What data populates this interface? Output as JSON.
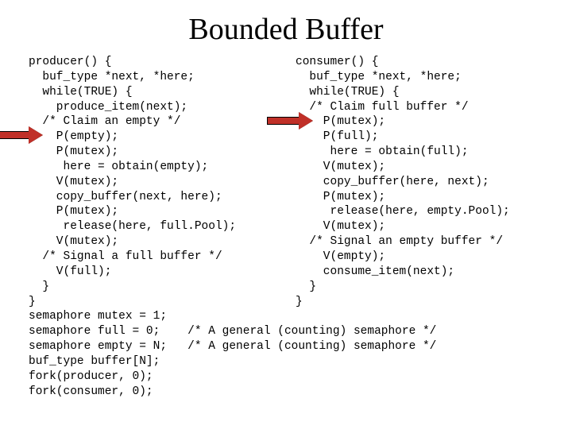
{
  "title": "Bounded Buffer",
  "producer_code": "producer() {\n  buf_type *next, *here;\n  while(TRUE) {\n    produce_item(next);\n  /* Claim an empty */\n    P(empty);\n    P(mutex);\n     here = obtain(empty);\n    V(mutex);\n    copy_buffer(next, here);\n    P(mutex);\n     release(here, full.Pool);\n    V(mutex);\n  /* Signal a full buffer */\n    V(full);\n  }\n}",
  "consumer_code": "consumer() {\n  buf_type *next, *here;\n  while(TRUE) {\n  /* Claim full buffer */\n    P(mutex);\n    P(full);\n     here = obtain(full);\n    V(mutex);\n    copy_buffer(here, next);\n    P(mutex);\n     release(here, empty.Pool);\n    V(mutex);\n  /* Signal an empty buffer */\n    V(empty);\n    consume_item(next);\n  }\n}",
  "bottom_code": "semaphore mutex = 1;\nsemaphore full = 0;    /* A general (counting) semaphore */\nsemaphore empty = N;   /* A general (counting) semaphore */\nbuf_type buffer[N];\nfork(producer, 0);\nfork(consumer, 0);"
}
